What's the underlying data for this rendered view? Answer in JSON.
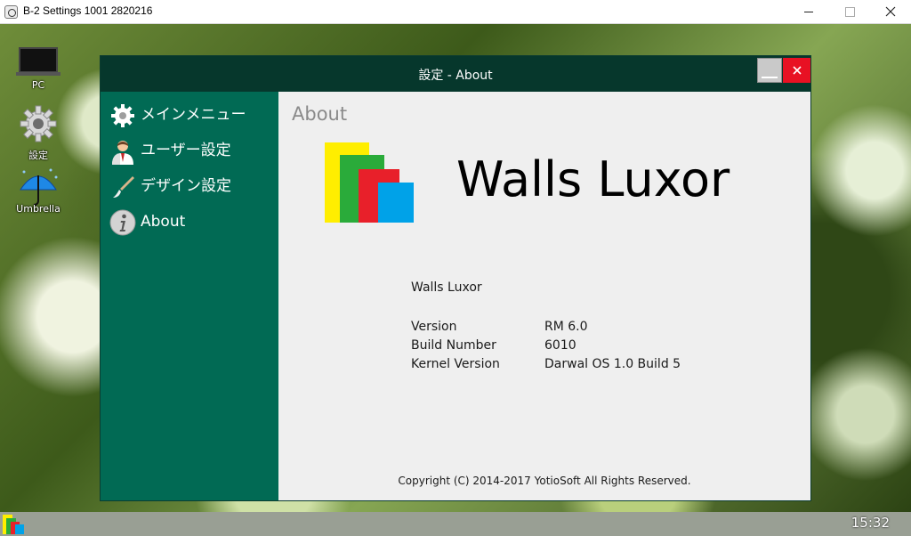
{
  "host_window": {
    "title": "B-2 Settings 1001 2820216"
  },
  "desktop": {
    "icons": [
      {
        "label": "PC",
        "icon": "monitor-icon"
      },
      {
        "label": "設定",
        "icon": "gear-icon"
      },
      {
        "label": "Umbrella",
        "icon": "umbrella-icon"
      }
    ]
  },
  "settings_window": {
    "title": "設定 - About",
    "titlebar_color": "#06372c",
    "close_color": "#e81123"
  },
  "sidebar": {
    "bg_color": "#016a54",
    "items": [
      {
        "label": "メインメニュー",
        "icon": "gear-icon"
      },
      {
        "label": "ユーザー設定",
        "icon": "user-icon"
      },
      {
        "label": "デザイン設定",
        "icon": "brush-icon"
      },
      {
        "label": "About",
        "icon": "info-icon"
      }
    ]
  },
  "about": {
    "heading": "About",
    "wordmark": "Walls Luxor",
    "product_name": "Walls Luxor",
    "logo_colors": [
      "#ffee00",
      "#2aab3a",
      "#e8202a",
      "#00a2e8"
    ],
    "rows": [
      {
        "key": "Version",
        "value": "RM 6.0"
      },
      {
        "key": "Build Number",
        "value": "6010"
      },
      {
        "key": "Kernel Version",
        "value": "Darwal OS 1.0 Build 5"
      }
    ],
    "copyright": "Copyright (C) 2014-2017 YotioSoft All Rights Reserved."
  },
  "taskbar": {
    "clock": "15:32"
  }
}
